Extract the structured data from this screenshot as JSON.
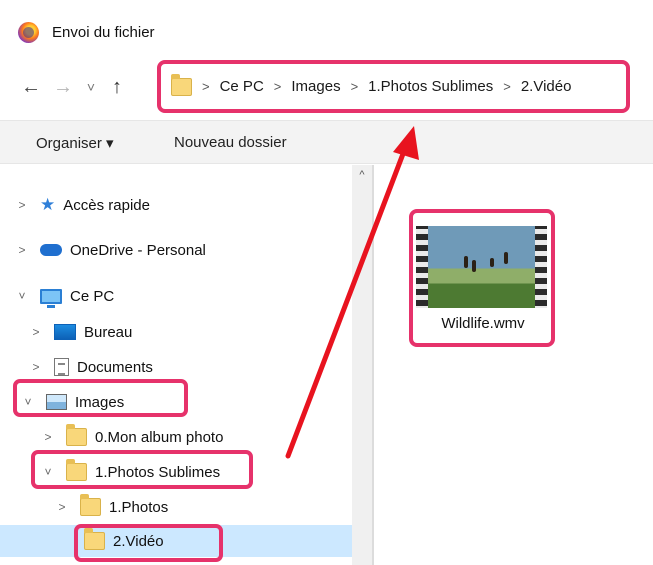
{
  "window": {
    "title": "Envoi du fichier"
  },
  "address_bar": {
    "segments": [
      "Ce PC",
      "Images",
      "1.Photos Sublimes",
      "2.Vidéo"
    ]
  },
  "toolbar": {
    "organiser_label": "Organiser ▾",
    "new_folder_label": "Nouveau dossier"
  },
  "tree": {
    "quick_access": "Accès rapide",
    "onedrive": "OneDrive - Personal",
    "this_pc": "Ce PC",
    "desktop": "Bureau",
    "documents": "Documents",
    "images": "Images",
    "album": "0.Mon album photo",
    "photos_sublimes": "1.Photos Sublimes",
    "photos": "1.Photos",
    "video": "2.Vidéo"
  },
  "files": [
    {
      "name": "Wildlife.wmv",
      "type": "video-thumbnail"
    }
  ],
  "colors": {
    "highlight": "#e6326b",
    "selection": "#cce8ff",
    "arrow": "#e8131f"
  }
}
